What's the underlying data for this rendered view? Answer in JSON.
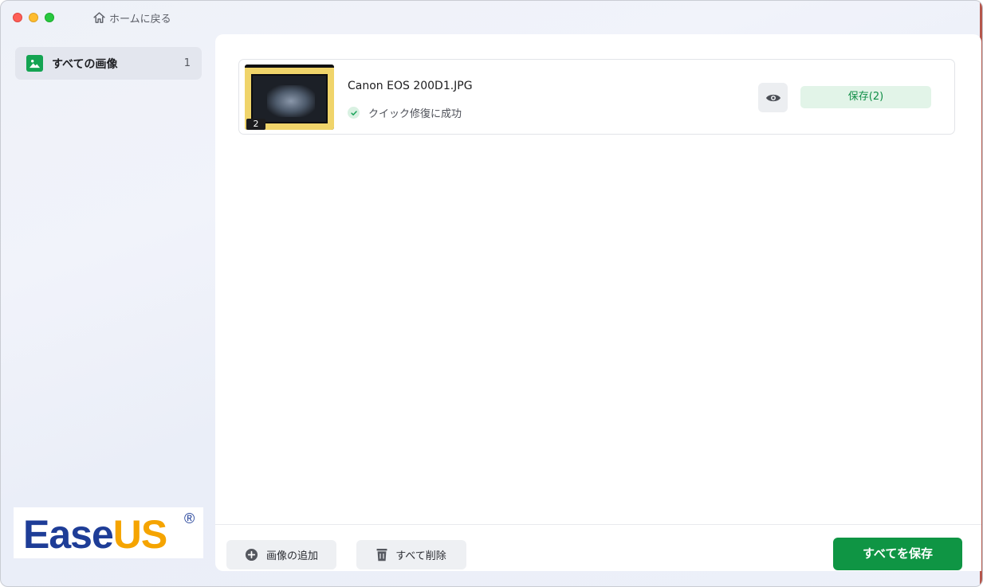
{
  "window": {
    "home_label": "ホームに戻る"
  },
  "sidebar": {
    "items": [
      {
        "label": "すべての画像",
        "count": "1",
        "icon": "image-icon",
        "selected": true
      }
    ]
  },
  "logo": {
    "text_ease": "Ease",
    "text_us": "US",
    "reg": "®"
  },
  "files": [
    {
      "name": "Canon EOS 200D1.JPG",
      "status": "クイック修復に成功",
      "badge": "2",
      "save_label": "保存(2)"
    }
  ],
  "footer": {
    "add_label": "画像の追加",
    "delete_label": "すべて削除",
    "save_all_label": "すべてを保存"
  },
  "colors": {
    "accent": "#0f9544",
    "accent_light": "#e2f4e8",
    "logo_blue": "#1e3d97",
    "logo_orange": "#f5a400"
  }
}
